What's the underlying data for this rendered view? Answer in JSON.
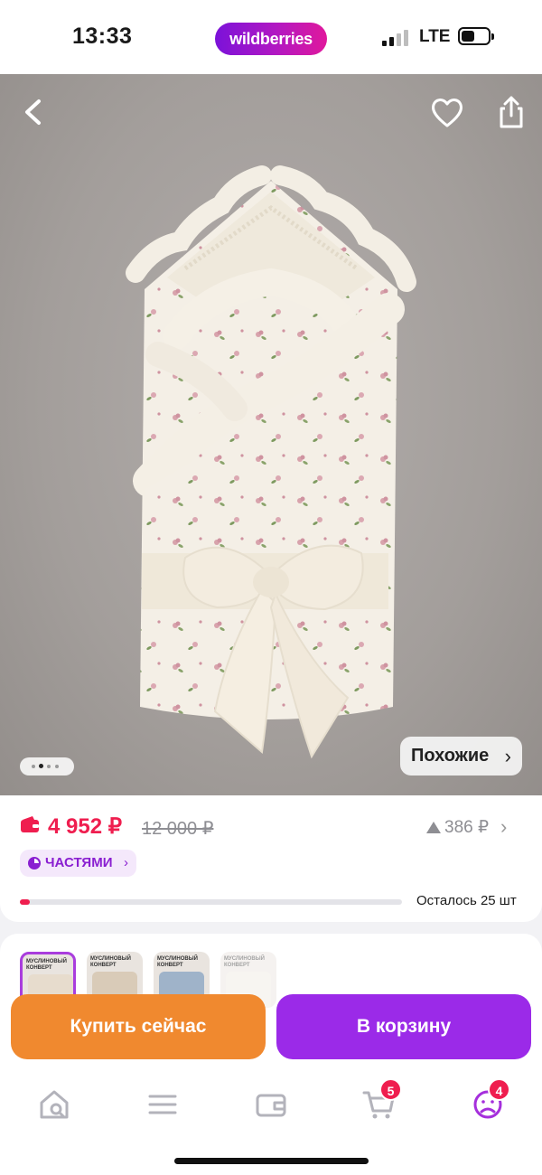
{
  "status_bar": {
    "time": "13:33",
    "brand": "wildberries",
    "network": "LTE",
    "signal_bars_active": 2,
    "signal_bars_total": 4,
    "battery_level": 0.5
  },
  "hero": {
    "icons": [
      "chevron-left-icon",
      "heart-icon",
      "share-icon"
    ],
    "carousel_total_dots": 4,
    "carousel_active_dot": 2,
    "similar_label": "Похожие",
    "similar_chevron": "›"
  },
  "price": {
    "current": "4 952 ₽",
    "old": "12 000 ₽",
    "alt": "386 ₽",
    "chevron": "›",
    "current_color": "#ef1e4f",
    "installments_label": "ЧАСТЯМИ",
    "installments_chevron": "›",
    "stock_label": "Осталось 25 шт",
    "stock_fraction": 0.026
  },
  "thumbnails": [
    {
      "caption": "МУСЛИНОВЫЙ КОНВЕРТ",
      "selected": true
    },
    {
      "caption": "МУСЛИНОВЫЙ КОНВЕРТ",
      "selected": false
    },
    {
      "caption": "МУСЛИНОВЫЙ КОНВЕРТ",
      "selected": false
    },
    {
      "caption": "МУСЛИНОВЫЙ КОНВЕРТ",
      "selected": false
    }
  ],
  "actions": {
    "buy_now": "Купить сейчас",
    "add_to_cart": "В корзину",
    "buy_color": "#f0892f",
    "cart_color": "#9b2ae8"
  },
  "tabbar": {
    "icons": [
      "home-search-icon",
      "catalog-menu-icon",
      "wallet-icon",
      "cart-icon",
      "profile-icon"
    ],
    "cart_badge": "5",
    "profile_badge": "4"
  }
}
